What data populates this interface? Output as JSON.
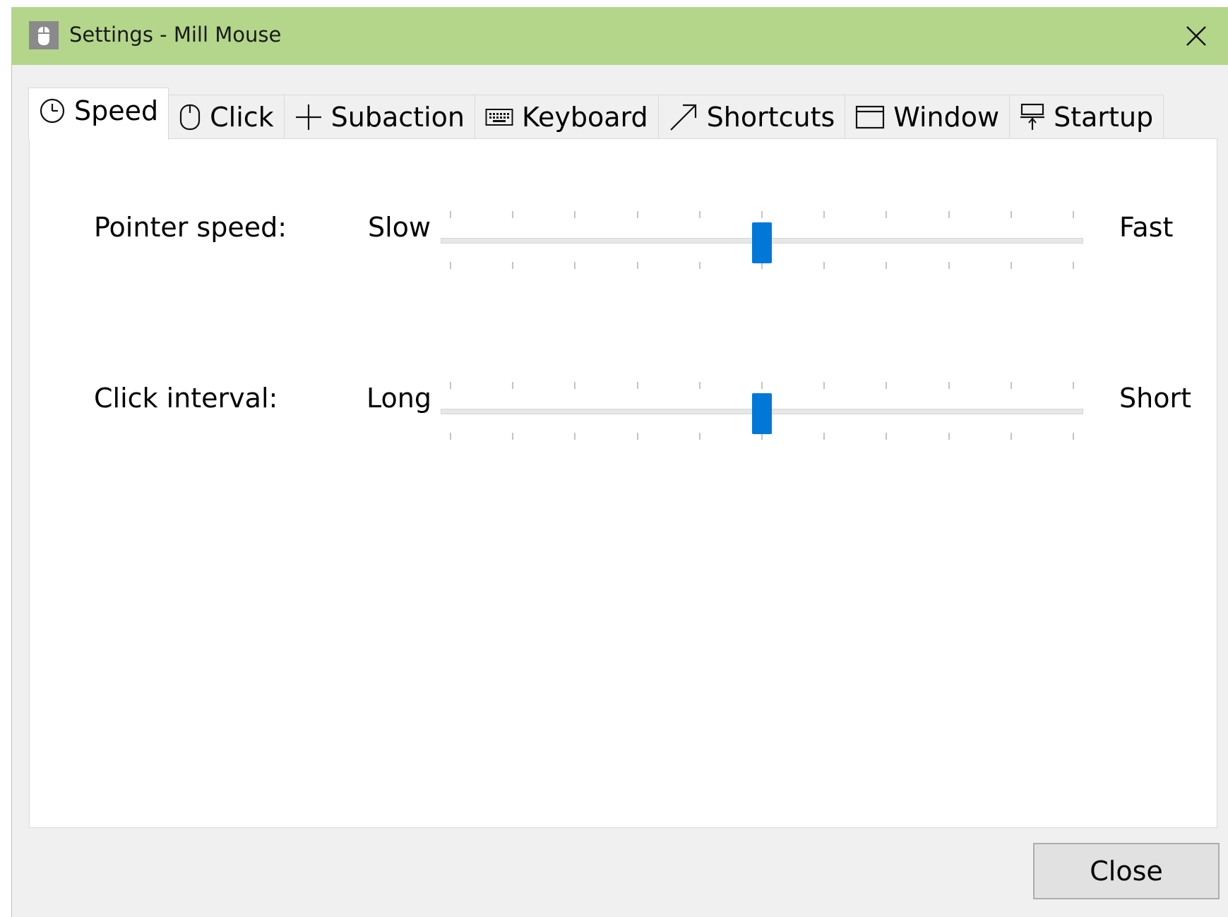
{
  "window": {
    "title": "Settings - Mill Mouse",
    "title_bar_color": "#b3d68b",
    "app_icon": "mouse-icon",
    "close_icon": "close-icon"
  },
  "tabs": [
    {
      "label": "Speed",
      "icon": "clock-icon",
      "active": true
    },
    {
      "label": "Click",
      "icon": "mouse-icon",
      "active": false
    },
    {
      "label": "Subaction",
      "icon": "plus-icon",
      "active": false
    },
    {
      "label": "Keyboard",
      "icon": "keyboard-icon",
      "active": false
    },
    {
      "label": "Shortcuts",
      "icon": "arrow-icon",
      "active": false
    },
    {
      "label": "Window",
      "icon": "window-icon",
      "active": false
    },
    {
      "label": "Startup",
      "icon": "pin-icon",
      "active": false
    }
  ],
  "settings": {
    "pointer_speed": {
      "label": "Pointer speed:",
      "min_label": "Slow",
      "max_label": "Fast",
      "ticks": 11,
      "value_fraction": 0.5
    },
    "click_interval": {
      "label": "Click interval:",
      "min_label": "Long",
      "max_label": "Short",
      "ticks": 11,
      "value_fraction": 0.5
    }
  },
  "footer": {
    "close_label": "Close"
  },
  "accent_color": "#0078d7"
}
